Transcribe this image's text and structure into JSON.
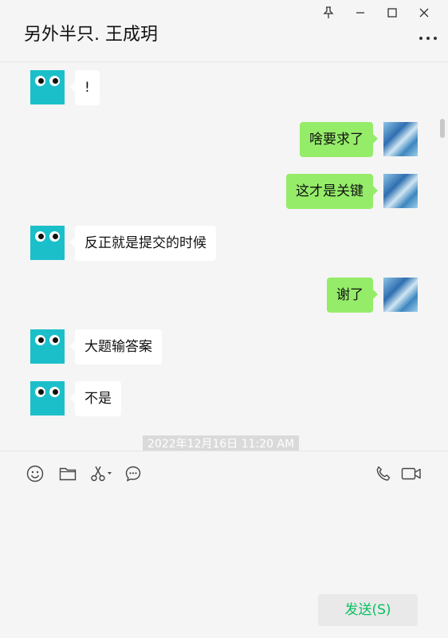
{
  "window": {
    "title": "另外半只. 王成玥",
    "controls": [
      "pin-icon",
      "minimize-icon",
      "maximize-icon",
      "close-icon"
    ],
    "more_icon": "more-icon"
  },
  "messages": [
    {
      "side": "in",
      "text": "!"
    },
    {
      "side": "out",
      "text": "啥要求了"
    },
    {
      "side": "out",
      "text": "这才是关键"
    },
    {
      "side": "in",
      "text": "反正就是提交的时候"
    },
    {
      "side": "out",
      "text": "谢了"
    },
    {
      "side": "in",
      "text": "大题输答案"
    },
    {
      "side": "in",
      "text": "不是"
    }
  ],
  "timestamp": "2022年12月16日 11:20 AM",
  "toolbar": {
    "left_icons": [
      "emoji-icon",
      "folder-icon",
      "scissors-icon",
      "chat-history-icon"
    ],
    "right_icons": [
      "phone-icon",
      "video-icon"
    ]
  },
  "input": {
    "value": ""
  },
  "send_button": {
    "label": "发送(S)"
  },
  "colors": {
    "outgoing_bubble": "#95ec69",
    "incoming_bubble": "#ffffff",
    "send_text": "#07c160",
    "bot_avatar": "#1bbfc9"
  }
}
